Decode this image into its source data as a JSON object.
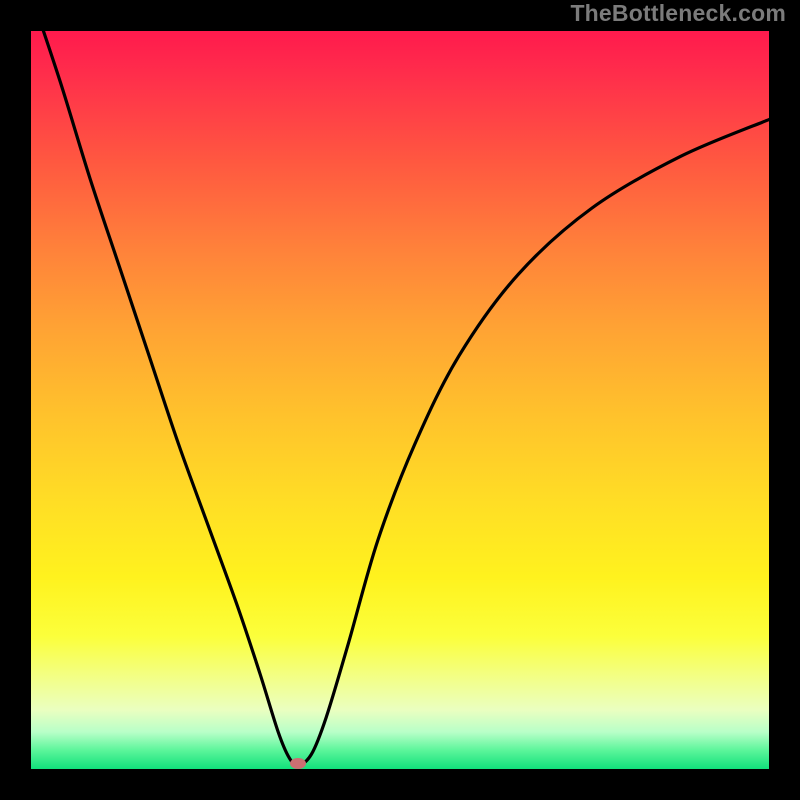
{
  "watermark": "TheBottleneck.com",
  "dot": {
    "x_frac": 0.362,
    "y_frac": 0.992
  },
  "chart_data": {
    "type": "line",
    "title": "",
    "xlabel": "",
    "ylabel": "",
    "xlim": [
      0,
      1
    ],
    "ylim": [
      0,
      1
    ],
    "series": [
      {
        "name": "bottleneck-curve",
        "x": [
          0.0,
          0.04,
          0.08,
          0.12,
          0.16,
          0.2,
          0.24,
          0.28,
          0.31,
          0.335,
          0.35,
          0.362,
          0.38,
          0.4,
          0.43,
          0.47,
          0.52,
          0.58,
          0.66,
          0.76,
          0.88,
          1.0
        ],
        "y": [
          1.05,
          0.93,
          0.8,
          0.68,
          0.56,
          0.44,
          0.33,
          0.22,
          0.13,
          0.05,
          0.015,
          0.005,
          0.02,
          0.07,
          0.17,
          0.31,
          0.44,
          0.56,
          0.67,
          0.76,
          0.83,
          0.88
        ]
      }
    ],
    "marker": {
      "x": 0.362,
      "y": 0.005
    },
    "background_gradient": {
      "top": "#ff1a4d",
      "mid": "#ffde25",
      "bottom": "#11e07b"
    }
  }
}
